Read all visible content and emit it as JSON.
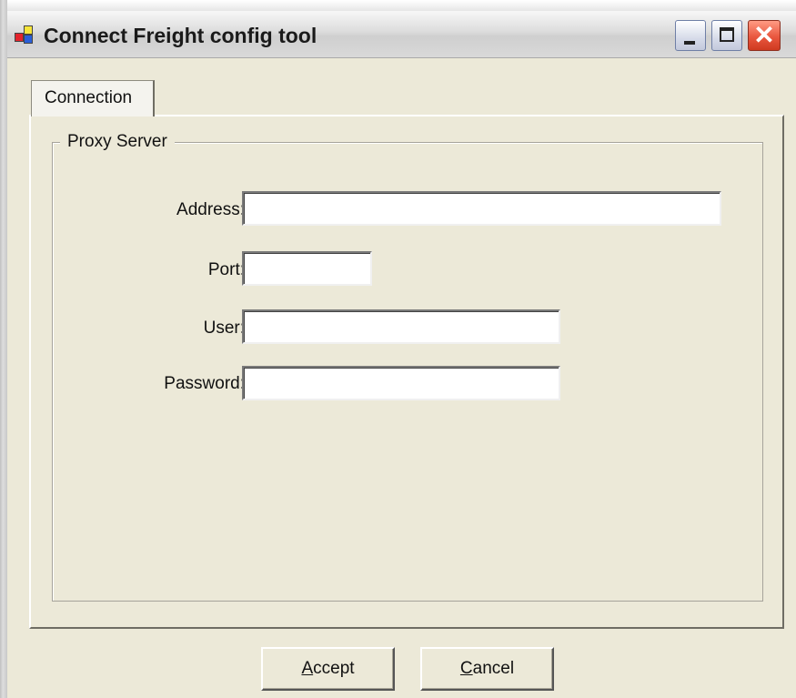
{
  "window": {
    "title": "Connect Freight config tool",
    "controls": {
      "minimize": "minimize",
      "maximize": "maximize",
      "close": "✕"
    }
  },
  "tabs": [
    {
      "label": "Connection",
      "selected": true
    }
  ],
  "groupbox": {
    "legend": "Proxy Server"
  },
  "fields": {
    "address": {
      "label": "Address:",
      "value": ""
    },
    "port": {
      "label": "Port:",
      "value": ""
    },
    "user": {
      "label": "User:",
      "value": ""
    },
    "password": {
      "label": "Password:",
      "value": ""
    }
  },
  "buttons": {
    "accept": {
      "mnemonic": "A",
      "rest": "ccept"
    },
    "cancel": {
      "mnemonic": "C",
      "rest": "ancel"
    }
  },
  "icons": {
    "app": "app-icon",
    "minimize": "minimize-icon",
    "maximize": "maximize-icon",
    "close": "close-icon"
  }
}
